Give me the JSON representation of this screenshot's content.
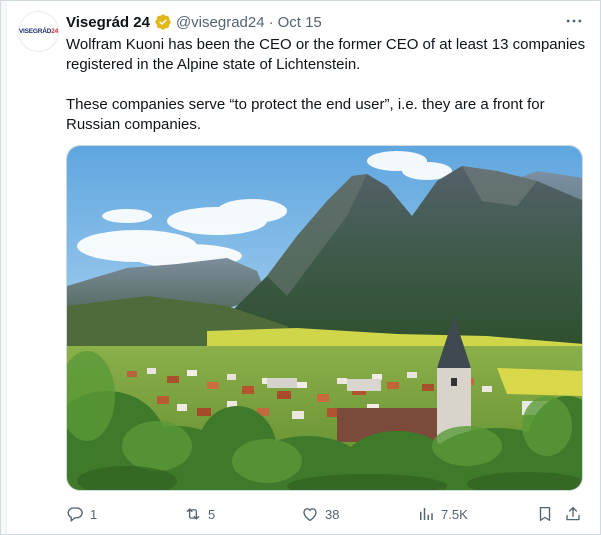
{
  "author": {
    "display_name": "Visegrád 24",
    "handle": "@visegrad24",
    "date": "Oct 15",
    "avatar_text_main": "VISEGRÁD",
    "avatar_text_num": "24"
  },
  "tweet": {
    "paragraph_1": "Wolfram Kuoni has been the CEO or the former CEO of at least 13 companies registered in the Alpine state of Lichtenstein.",
    "paragraph_2": "These companies serve “to protect the end user”, i.e. they are a front for Russian companies."
  },
  "metrics": {
    "replies": "1",
    "retweets": "5",
    "likes": "38",
    "views": "7.5K"
  },
  "icons": {
    "verified": "verified-badge-icon",
    "more": "more-icon",
    "reply": "reply-icon",
    "retweet": "retweet-icon",
    "like": "heart-icon",
    "views": "views-icon",
    "bookmark": "bookmark-icon",
    "share": "share-icon"
  },
  "colors": {
    "verified_gold": "#e2b719",
    "secondary_text": "#536471",
    "primary_text": "#0f1419"
  }
}
